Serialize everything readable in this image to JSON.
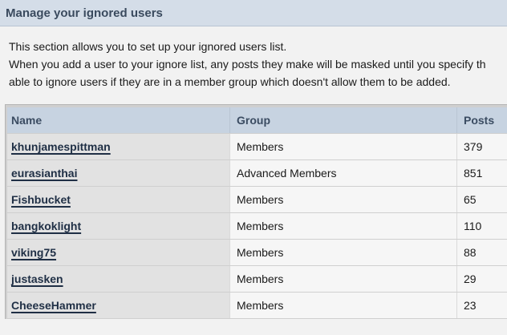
{
  "header": {
    "title": "Manage your ignored users"
  },
  "intro": {
    "line1": "This section allows you to set up your ignored users list.",
    "line2": "When you add a user to your ignore list, any posts they make will be masked until you specify th",
    "line3": "able to ignore users if they are in a member group which doesn't allow them to be added."
  },
  "table": {
    "columns": {
      "name": "Name",
      "group": "Group",
      "posts": "Posts"
    },
    "rows": [
      {
        "name": "khunjamespittman",
        "group": "Members",
        "posts": "379"
      },
      {
        "name": "eurasianthai",
        "group": "Advanced Members",
        "posts": "851"
      },
      {
        "name": "Fishbucket",
        "group": "Members",
        "posts": "65"
      },
      {
        "name": "bangkoklight",
        "group": "Members",
        "posts": "110"
      },
      {
        "name": "viking75",
        "group": "Members",
        "posts": "88"
      },
      {
        "name": "justasken",
        "group": "Members",
        "posts": "29"
      },
      {
        "name": "CheeseHammer",
        "group": "Members",
        "posts": "23"
      }
    ]
  }
}
